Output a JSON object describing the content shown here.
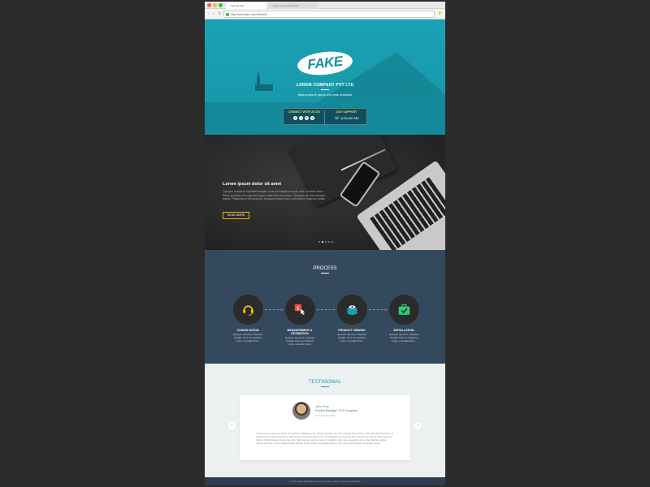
{
  "browser": {
    "active_tab": "Sample Site",
    "inactive_tab": "Fake Company Website",
    "url": "http://www.fake.com/Website",
    "back_icon": "back-icon",
    "forward_icon": "forward-icon",
    "reload_icon": "reload-icon"
  },
  "hero": {
    "logo_text": "FAKE",
    "company": "LOREM COMPANY PVT LTD",
    "tagline": "Maecenas et purus leo proin tincidunt",
    "contact": {
      "left_heading": "CONNECT WITH US ON",
      "social": [
        "f",
        "t",
        "in",
        "g"
      ],
      "right_heading": "24x7 SUPPORT",
      "phone": "(123) 567-890"
    }
  },
  "slider": {
    "title": "Lorem ipsum dolor sit amet",
    "text": "Quisque faucibus vulputate fringilla. Duis sed dapibus turpis, sed convallis libero. Etiam gravida eros egestas augue imperdiet accumsan. Quisque sit amet semper ipsum. Phasellus et lectus justo. Quisque luctus id leo a hendrerit, vivamus mollis.",
    "button": "READ MORE"
  },
  "process": {
    "title": "PROCESS",
    "steps": [
      {
        "label": "CONSULTATION",
        "desc": "Quisque faucibus vulputate fringilla. Duis sed dapibus turpis, convallis libero."
      },
      {
        "label": "MEASUREMENT & ESTIMATION",
        "desc": "Quisque faucibus vulputate fringilla. Duis sed dapibus turpis, convallis libero."
      },
      {
        "label": "PRODUCT VIEWING",
        "desc": "Quisque faucibus vulputate fringilla. Duis sed dapibus turpis, convallis libero."
      },
      {
        "label": "INSTALLATION",
        "desc": "Quisque faucibus vulputate fringilla. Duis sed dapibus turpis, convallis libero."
      }
    ]
  },
  "testimonial": {
    "title": "TESTIMONIAL",
    "name": "John Doe",
    "role": "Product Manager, XYZ Company",
    "date": "1st February 2016",
    "text": "\"Lorem ipsum dolor sit amet, consectetur adipiscing elit. Morbi egestas, nisi non volutpat fermentum, velit nulla lacinia augue, at mattis justo augue vitae lacus. Maecenas commodo ante tortor, vel tincidunt est rhoncus quis. Nullam ac velit at risus placerat dictum. Pellentesque tempus leo dui. Sed pretium, velit eu tempor tincidunt, ante lacus egestas urna, vitae facilisis sapien mauris sit amet metus. Pellentesque auctor, ipsum vitae consequat pretium, elit metus luctus diam, at lacinia metus.\""
  },
  "footer": {
    "text": "© 2016 www.fakewebsite.com   |   privacy policy   |   terms & conditions"
  },
  "colors": {
    "teal": "#1aa2b4",
    "navy": "#34495e",
    "gold": "#f0b400"
  }
}
